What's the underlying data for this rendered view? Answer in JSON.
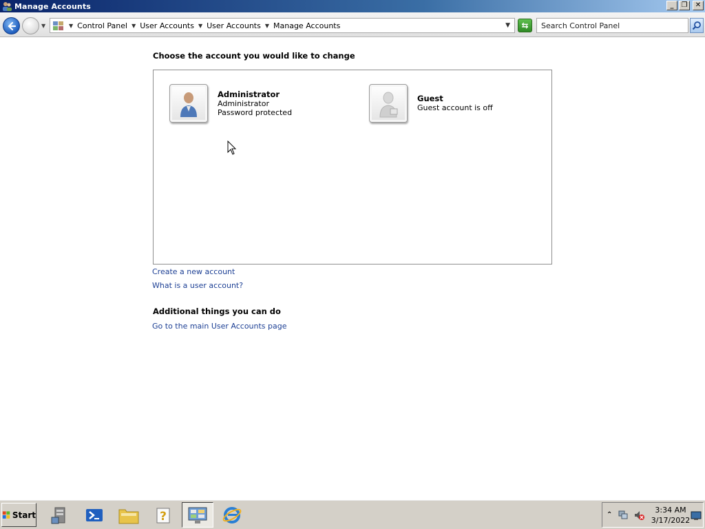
{
  "window": {
    "title": "Manage Accounts",
    "controls": {
      "minimize": "_",
      "restore": "❐",
      "close": "✕"
    }
  },
  "navbar": {
    "breadcrumbs": [
      "Control Panel",
      "User Accounts",
      "User Accounts",
      "Manage Accounts"
    ],
    "search_placeholder": "Search Control Panel"
  },
  "main": {
    "heading": "Choose the account you would like to change",
    "accounts": [
      {
        "name": "Administrator",
        "lines": [
          "Administrator",
          "Password protected"
        ]
      },
      {
        "name": "Guest",
        "lines": [
          "Guest account is off"
        ]
      }
    ],
    "links": [
      "Create a new account",
      "What is a user account?"
    ],
    "additional_heading": "Additional things you can do",
    "additional_links": [
      "Go to the main User Accounts page"
    ]
  },
  "taskbar": {
    "start_label": "Start",
    "apps": [
      "server-manager",
      "powershell",
      "file-explorer",
      "help",
      "control-panel",
      "internet-explorer"
    ],
    "active_app": "control-panel",
    "clock_time": "3:34 AM",
    "clock_date": "3/17/2022"
  },
  "colors": {
    "link": "#1c3f94",
    "titlebar_start": "#0a246a",
    "titlebar_end": "#a6caf0",
    "taskbar": "#d4d0c8"
  }
}
